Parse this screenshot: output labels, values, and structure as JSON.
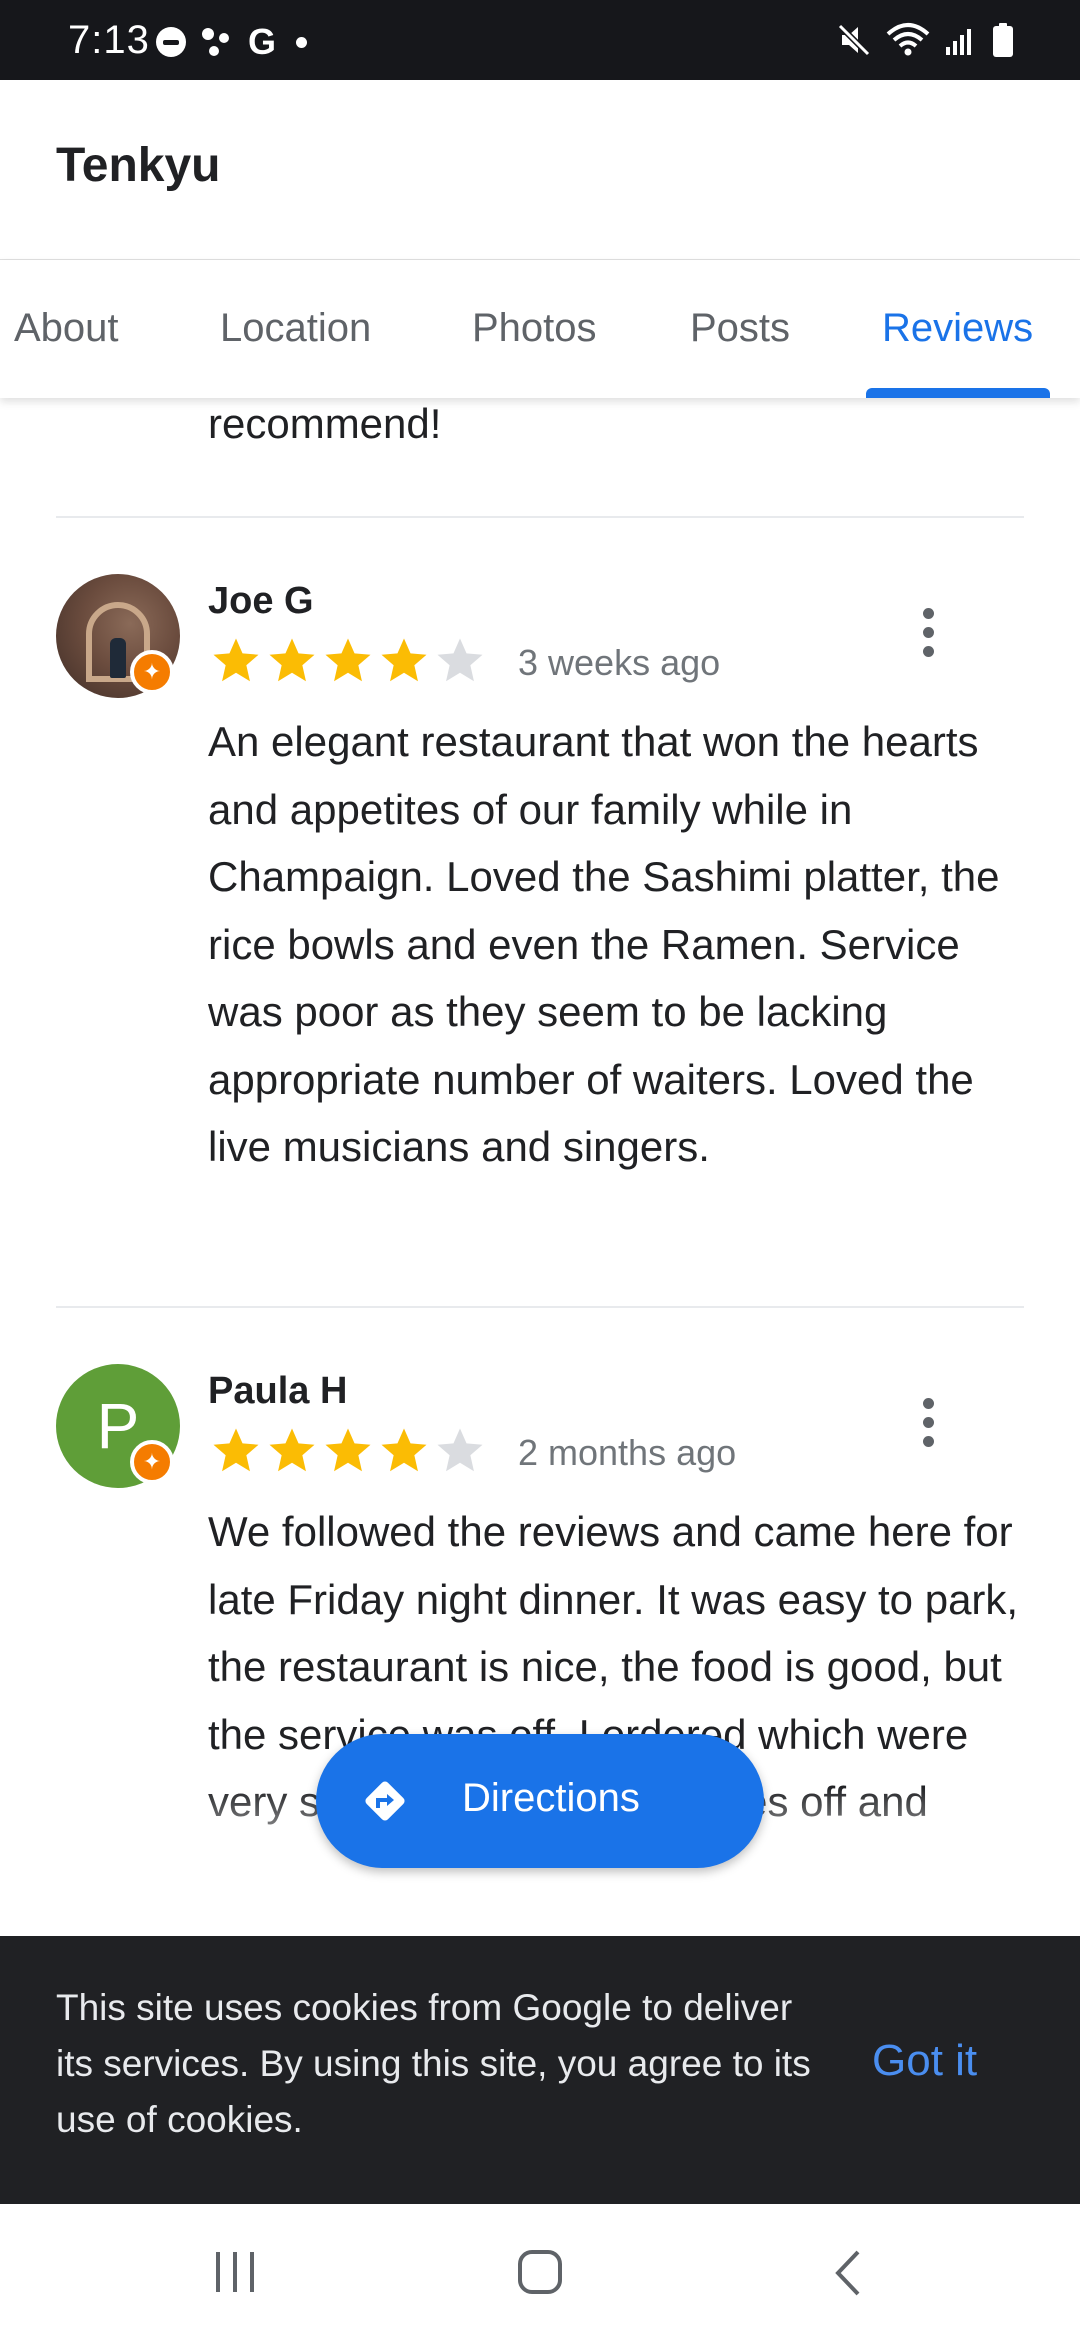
{
  "status_bar": {
    "time": "7:13",
    "left_icons": [
      "do-not-disturb-icon",
      "notification-dots-icon",
      "google-g-icon",
      "dot-icon"
    ],
    "right_icons": [
      "mute-icon",
      "wifi-icon",
      "signal-icon",
      "battery-icon"
    ],
    "g_glyph": "G"
  },
  "header": {
    "title": "Tenkyu"
  },
  "tabs": [
    {
      "label": "About",
      "active": false
    },
    {
      "label": "Location",
      "active": false
    },
    {
      "label": "Photos",
      "active": false
    },
    {
      "label": "Posts",
      "active": false
    },
    {
      "label": "Reviews",
      "active": true
    }
  ],
  "previous_review_tail": "recommend!",
  "reviews": [
    {
      "name": "Joe G",
      "avatar": "photo",
      "rating": 4,
      "max_rating": 5,
      "time": "3 weeks ago",
      "text": "An elegant restaurant that won the hearts and appetites of our family while in Champaign. Loved the Sashimi platter, the rice bowls and even the Ramen. Service was poor as they seem to be lacking appropriate number of waiters. Loved the live musicians and singers."
    },
    {
      "name": "Paula H",
      "avatar": "letter",
      "avatar_letter": "P",
      "avatar_color": "#5f9e38",
      "rating": 4,
      "max_rating": 5,
      "time": "2 months ago",
      "text": "We followed the reviews and came here for late Friday night dinner. It was easy to park, the restaurant is nice, the food is good, but the service was off. I ordered which were very spicy. I scraped the spices off and"
    }
  ],
  "fab": {
    "label": "Directions",
    "icon": "directions-icon"
  },
  "cookie_banner": {
    "text": "This site uses cookies from Google to deliver its services. By using this site, you agree to its use of cookies.",
    "button": "Got it"
  },
  "nav_bar": {
    "buttons": [
      "recents-icon",
      "home-icon",
      "back-icon"
    ]
  },
  "colors": {
    "accent": "#1a73e8",
    "star": "#fbbc04",
    "star_empty": "#dadce0",
    "banner": "#202124",
    "status_bar": "#16171b"
  }
}
